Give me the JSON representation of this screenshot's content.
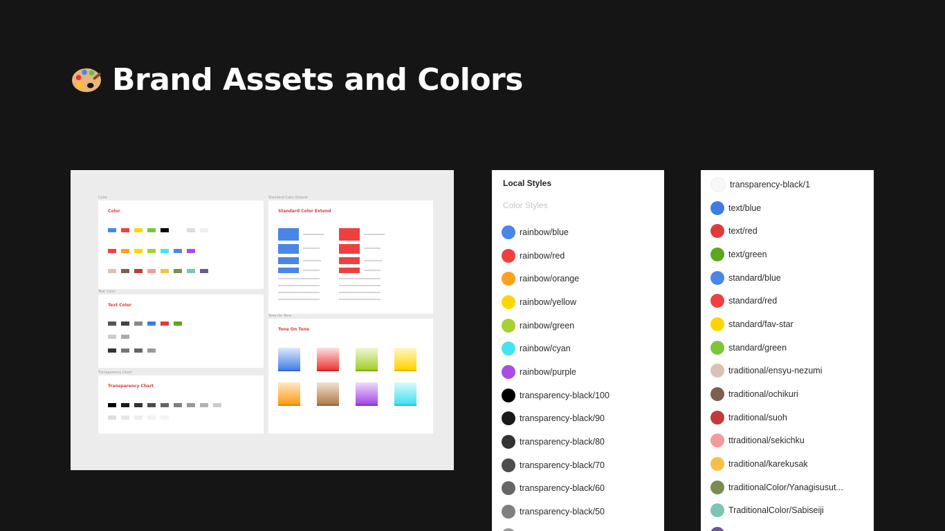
{
  "page": {
    "title": "Brand Assets and Colors"
  },
  "canvas": {
    "frames": [
      {
        "label": "Color",
        "title": "Color"
      },
      {
        "label": "Standard Color Extend",
        "title": "Standard Color Extend"
      },
      {
        "label": "Text Color",
        "title": "Text Color"
      },
      {
        "label": "Tone On Tone",
        "title": "Tone On Tone"
      },
      {
        "label": "Transparency Chart",
        "title": "Transparency Chart"
      }
    ]
  },
  "styles_panel": {
    "title": "Local Styles",
    "subtitle": "Color Styles",
    "items": [
      {
        "label": "rainbow/blue",
        "color": "#4a86e8"
      },
      {
        "label": "rainbow/red",
        "color": "#ef4040"
      },
      {
        "label": "rainbow/orange",
        "color": "#ff9f1a"
      },
      {
        "label": "rainbow/yellow",
        "color": "#ffd500"
      },
      {
        "label": "rainbow/green",
        "color": "#a6d12e"
      },
      {
        "label": "rainbow/cyan",
        "color": "#45e3f2"
      },
      {
        "label": "rainbow/purple",
        "color": "#a64ee6"
      },
      {
        "label": "transparency-black/100",
        "color": "#000000"
      },
      {
        "label": "transparency-black/90",
        "color": "#1a1a1a"
      },
      {
        "label": "transparency-black/80",
        "color": "#333333"
      },
      {
        "label": "transparency-black/70",
        "color": "#4d4d4d"
      },
      {
        "label": "transparency-black/60",
        "color": "#666666"
      },
      {
        "label": "transparency-black/50",
        "color": "#808080"
      },
      {
        "label": "",
        "color": "#999999"
      }
    ]
  },
  "styles_panel_2": {
    "items": [
      {
        "label": "transparency-black/1",
        "color": "#f7f7f7"
      },
      {
        "label": "text/blue",
        "color": "#3d7ee0"
      },
      {
        "label": "text/red",
        "color": "#e03a3a"
      },
      {
        "label": "text/green",
        "color": "#5aa81c"
      },
      {
        "label": "standard/blue",
        "color": "#4a86e8"
      },
      {
        "label": "standard/red",
        "color": "#ef4040"
      },
      {
        "label": "standard/fav-star",
        "color": "#ffd500"
      },
      {
        "label": "standard/green",
        "color": "#7cc63a"
      },
      {
        "label": "traditional/ensyu-nezumi",
        "color": "#d9c3b4"
      },
      {
        "label": "traditional/ochikuri",
        "color": "#7e5e4f"
      },
      {
        "label": "traditional/suoh",
        "color": "#c23a3a"
      },
      {
        "label": "ttraditional/sekichku",
        "color": "#f59a9a"
      },
      {
        "label": "traditional/karekusak",
        "color": "#f7bf47"
      },
      {
        "label": "traditionalColor/Yanagisusut...",
        "color": "#7b8c52"
      },
      {
        "label": "TraditionalColor/Sabiseiji",
        "color": "#7cc4b4"
      },
      {
        "label": "",
        "color": "#6b5b8c"
      }
    ]
  }
}
